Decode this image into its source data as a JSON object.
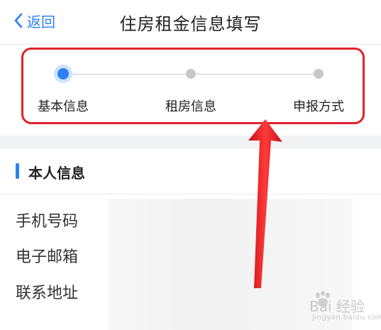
{
  "header": {
    "back_label": "返回",
    "title": "住房租金信息填写"
  },
  "steps": {
    "items": [
      {
        "label": "基本信息",
        "active": true
      },
      {
        "label": "租房信息",
        "active": false
      },
      {
        "label": "申报方式",
        "active": false
      }
    ]
  },
  "section": {
    "title": "本人信息"
  },
  "fields": [
    {
      "label": "手机号码"
    },
    {
      "label": "电子邮箱"
    },
    {
      "label": "联系地址"
    }
  ],
  "watermark": {
    "main": "Bai 经验",
    "sub": "jingyan.baidu.com"
  },
  "colors": {
    "accent": "#2d7ff3",
    "highlight": "#e2202a",
    "inactive_dot": "#c8c8c8"
  }
}
